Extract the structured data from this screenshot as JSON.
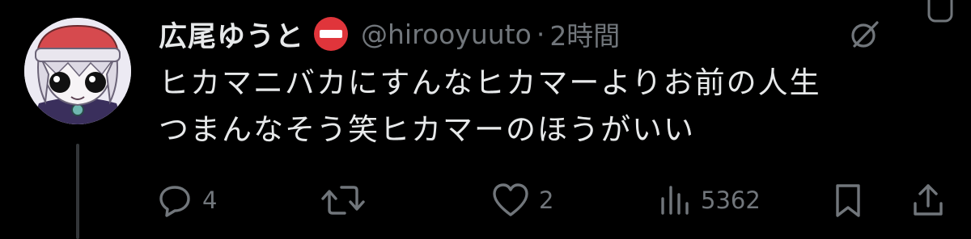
{
  "tweet": {
    "display_name": "広尾ゆうと",
    "badge_icon": "no-entry-emoji",
    "handle": "@hirooyuuto",
    "separator": "·",
    "timestamp": "2時間",
    "text_lines": [
      "ヒカマニバカにすんなヒカマーよりお前の人生",
      "つまんなそう笑ヒカマーのほうがいい"
    ]
  },
  "actions": {
    "reply": {
      "icon": "reply-icon",
      "count": "4"
    },
    "repost": {
      "icon": "repost-icon",
      "count": ""
    },
    "like": {
      "icon": "heart-icon",
      "count": "2"
    },
    "views": {
      "icon": "views-icon",
      "count": "5362"
    },
    "bookmark": {
      "icon": "bookmark-icon"
    },
    "share": {
      "icon": "share-icon"
    }
  },
  "colors": {
    "background": "#000000",
    "text_primary": "#e7e9ea",
    "text_secondary": "#71767b",
    "thread_line": "#333639",
    "badge_red": "#e0353b"
  }
}
